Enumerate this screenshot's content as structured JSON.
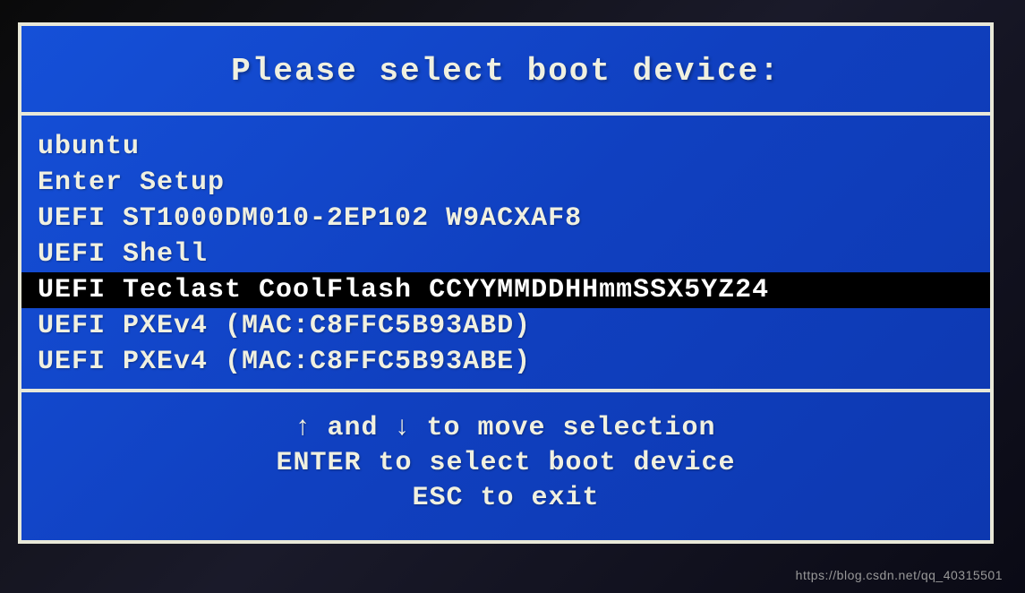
{
  "title": "Please select boot device:",
  "boot_items": [
    {
      "label": "ubuntu",
      "selected": false
    },
    {
      "label": "Enter Setup",
      "selected": false
    },
    {
      "label": "UEFI ST1000DM010-2EP102 W9ACXAF8",
      "selected": false
    },
    {
      "label": "UEFI Shell",
      "selected": false
    },
    {
      "label": "UEFI Teclast CoolFlash CCYYMMDDHHmmSSX5YZ24",
      "selected": true
    },
    {
      "label": "UEFI PXEv4 (MAC:C8FFC5B93ABD)",
      "selected": false
    },
    {
      "label": "UEFI PXEv4 (MAC:C8FFC5B93ABE)",
      "selected": false
    }
  ],
  "help": {
    "line1_prefix": "",
    "arrow_up": "↑",
    "line1_mid": " and ",
    "arrow_down": "↓",
    "line1_suffix": " to move selection",
    "line2": "ENTER to select boot device",
    "line3": "ESC to exit"
  },
  "watermark": "https://blog.csdn.net/qq_40315501"
}
